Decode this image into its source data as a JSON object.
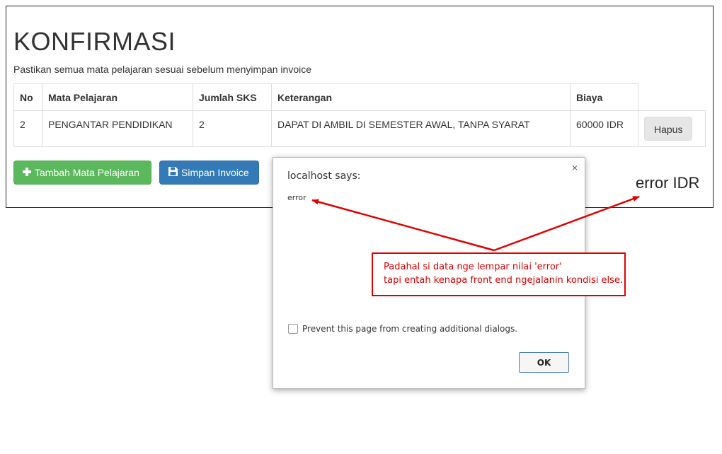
{
  "page": {
    "title": "KONFIRMASI",
    "subtitle": "Pastikan semua mata pelajaran sesuai sebelum menyimpan invoice"
  },
  "table": {
    "headers": [
      "No",
      "Mata Pelajaran",
      "Jumlah SKS",
      "Keterangan",
      "Biaya"
    ],
    "rows": [
      {
        "no": "2",
        "mata_pelajaran": "PENGANTAR PENDIDIKAN",
        "jumlah_sks": "2",
        "keterangan": "DAPAT DI AMBIL DI SEMESTER AWAL, TANPA SYARAT",
        "biaya": "60000 IDR",
        "action_label": "Hapus"
      }
    ]
  },
  "buttons": {
    "tambah_label": "Tambah Mata Pelajaran",
    "simpan_label": "Simpan Invoice"
  },
  "total_text": "error IDR",
  "dialog": {
    "title": "localhost says:",
    "message": "error",
    "checkbox_label": "Prevent this page from creating additional dialogs.",
    "ok_label": "OK",
    "close_symbol": "×"
  },
  "annotation": {
    "line1": "Padahal si data nge lempar nilai 'error'",
    "line2": "tapi entah kenapa front end ngejalanin kondisi else.",
    "color": "#e00000"
  },
  "colors": {
    "success": "#5cb85c",
    "primary": "#337ab7",
    "annotation_red": "#e00000"
  },
  "icons": {
    "tambah": "plus-icon",
    "simpan": "floppy-disk-icon"
  }
}
